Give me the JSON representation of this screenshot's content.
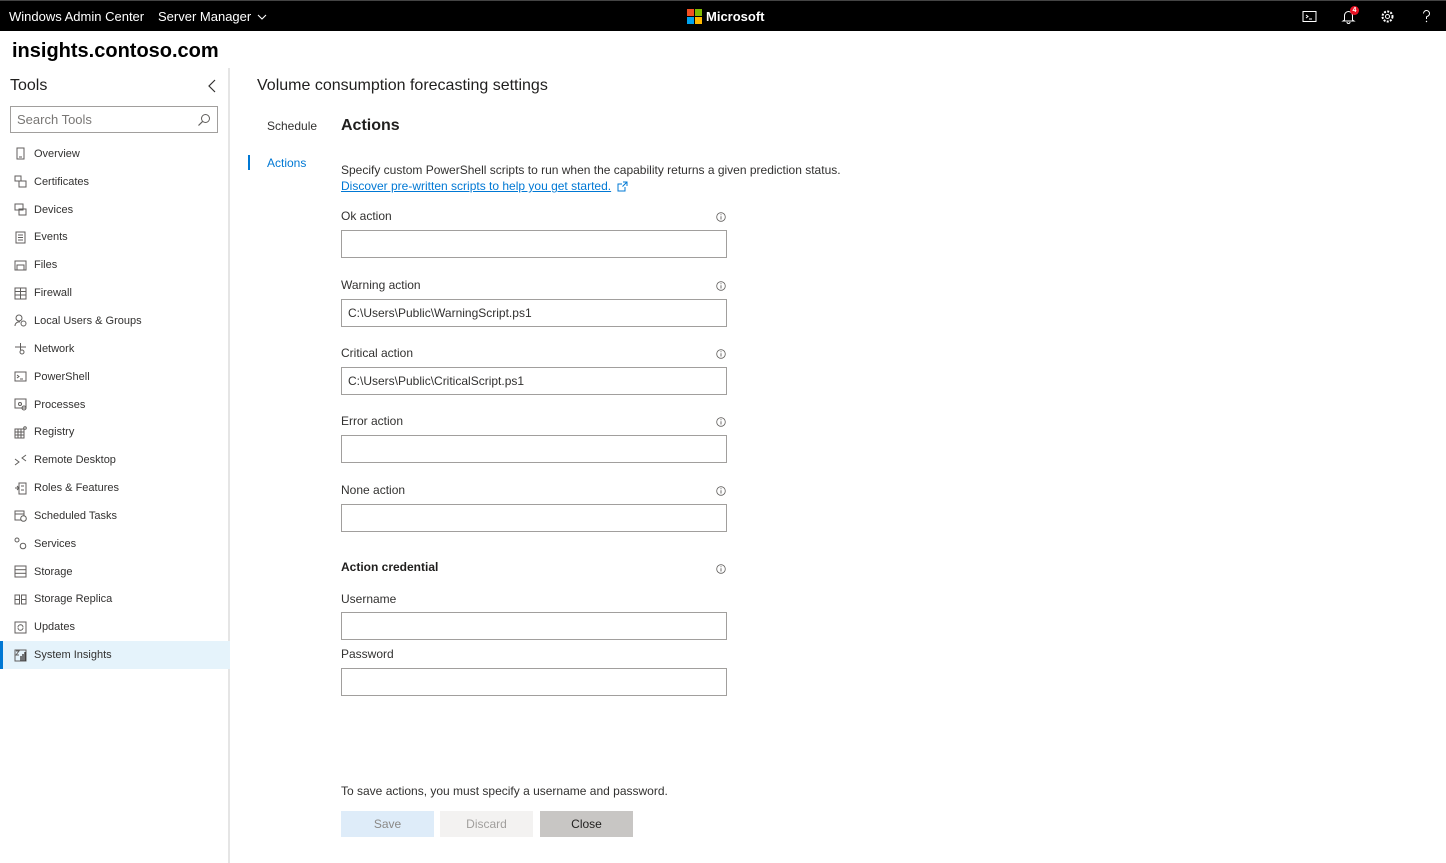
{
  "topbar": {
    "app_title": "Windows Admin Center",
    "server_manager_label": "Server Manager",
    "brand": "Microsoft",
    "notification_count": "4",
    "icons": [
      "console-icon",
      "notification-bell-icon",
      "settings-gear-icon",
      "help-icon"
    ]
  },
  "server_name": "insights.contoso.com",
  "sidebar": {
    "title": "Tools",
    "search_placeholder": "Search Tools",
    "items": [
      {
        "label": "Overview",
        "icon": "overview-icon"
      },
      {
        "label": "Certificates",
        "icon": "certificates-icon"
      },
      {
        "label": "Devices",
        "icon": "devices-icon"
      },
      {
        "label": "Events",
        "icon": "events-icon"
      },
      {
        "label": "Files",
        "icon": "files-icon"
      },
      {
        "label": "Firewall",
        "icon": "firewall-icon"
      },
      {
        "label": "Local Users & Groups",
        "icon": "users-icon"
      },
      {
        "label": "Network",
        "icon": "network-icon"
      },
      {
        "label": "PowerShell",
        "icon": "powershell-icon"
      },
      {
        "label": "Processes",
        "icon": "processes-icon"
      },
      {
        "label": "Registry",
        "icon": "registry-icon"
      },
      {
        "label": "Remote Desktop",
        "icon": "remote-desktop-icon"
      },
      {
        "label": "Roles & Features",
        "icon": "roles-features-icon"
      },
      {
        "label": "Scheduled Tasks",
        "icon": "scheduled-tasks-icon"
      },
      {
        "label": "Services",
        "icon": "services-icon"
      },
      {
        "label": "Storage",
        "icon": "storage-icon"
      },
      {
        "label": "Storage Replica",
        "icon": "storage-replica-icon"
      },
      {
        "label": "Updates",
        "icon": "updates-icon"
      },
      {
        "label": "System Insights",
        "icon": "system-insights-icon",
        "active": true
      }
    ]
  },
  "main": {
    "page_title": "Volume consumption forecasting settings",
    "subnav": {
      "schedule": "Schedule",
      "actions": "Actions",
      "active": "Actions"
    },
    "section_title": "Actions",
    "description": "Specify custom PowerShell scripts to run when the capability returns a given prediction status.",
    "link_text": "Discover pre-written scripts to help you get started.",
    "fields": [
      {
        "label": "Ok action",
        "value": ""
      },
      {
        "label": "Warning action",
        "value": "C:\\Users\\Public\\WarningScript.ps1"
      },
      {
        "label": "Critical action",
        "value": "C:\\Users\\Public\\CriticalScript.ps1"
      },
      {
        "label": "Error action",
        "value": ""
      },
      {
        "label": "None action",
        "value": ""
      }
    ],
    "credential": {
      "title": "Action credential",
      "username_label": "Username",
      "username_value": "",
      "password_label": "Password",
      "password_value": ""
    },
    "save_note": "To save actions, you must specify a username and password.",
    "buttons": {
      "save": "Save",
      "discard": "Discard",
      "close": "Close"
    }
  },
  "colors": {
    "accent": "#0078d4",
    "topbar_bg": "#000000",
    "active_item_bg": "#e5f3fb",
    "notification_badge": "#e81123"
  }
}
